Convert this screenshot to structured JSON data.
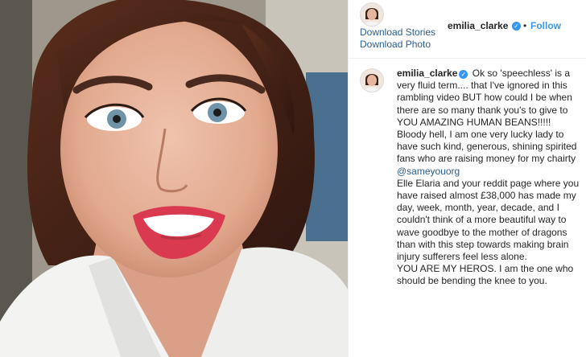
{
  "post": {
    "username": "emilia_clarke",
    "follow_label": "Follow",
    "separator": "•"
  },
  "downloads": {
    "stories_label": "Download Stories",
    "photo_label": "Download Photo"
  },
  "caption": {
    "username": "emilia_clarke",
    "text_part1": "Ok so 'speechless' is a very fluid term.... that I've ignored in this rambling video BUT how could I be when there are so many thank you's to give to YOU AMAZING HUMAN BEANS!!!!! Bloody hell, I am one very lucky lady to have such kind, generous, shining spirited fans who are raising money for my chairty",
    "mention": "@sameyouorg",
    "text_part2": "Elle Elaria and your reddit page where you have raised almost £38,000 has made my day, week, month, year, decade, and I couldn't think of a more beautiful way to wave goodbye to the mother of dragons than with this step towards making brain injury sufferers feel less alone.",
    "text_part3": "YOU ARE MY HEROS. I am the one who should be bending the knee to you."
  },
  "colors": {
    "link": "#2b5d8f",
    "follow": "#3897f0",
    "verified": "#3897f0"
  },
  "icons": {
    "verified": "verified-badge-icon",
    "avatar": "profile-avatar"
  }
}
